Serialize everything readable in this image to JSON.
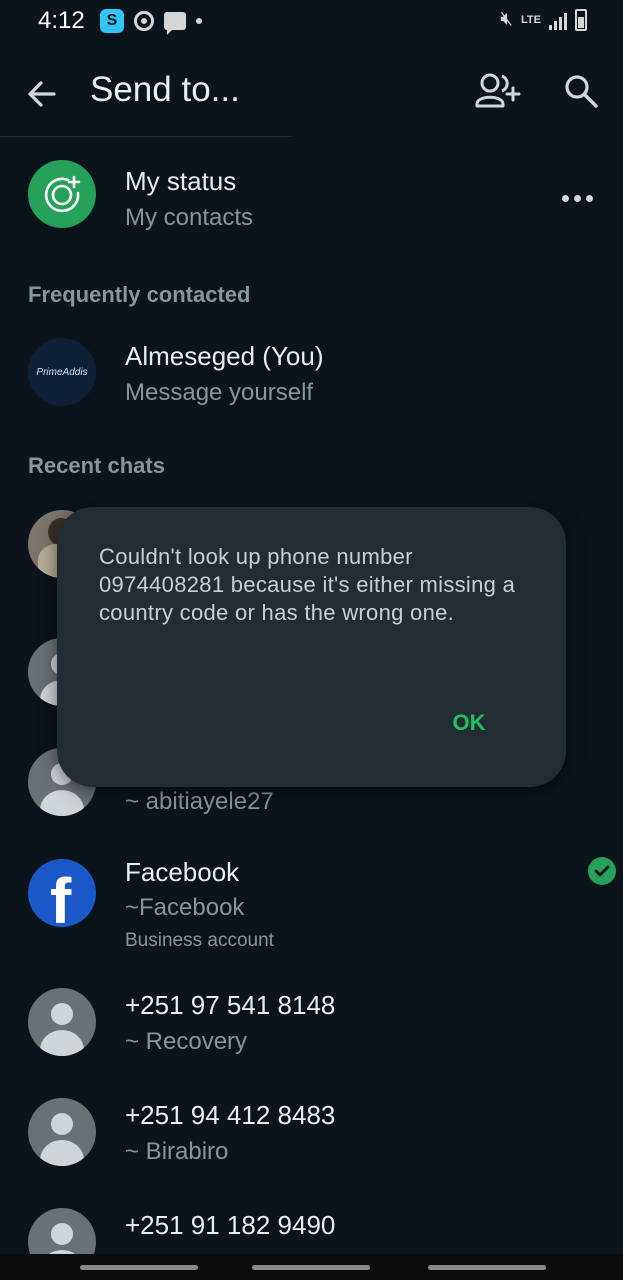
{
  "status_bar": {
    "time": "4:12",
    "app_icon_letter": "S",
    "network": "LTE"
  },
  "header": {
    "title": "Send to..."
  },
  "my_status": {
    "name": "My status",
    "subtitle": "My contacts"
  },
  "sections": {
    "frequent": "Frequently contacted",
    "recent": "Recent chats"
  },
  "frequent_contacts": [
    {
      "name": "Almeseged (You)",
      "subtitle": "Message yourself",
      "avatar_text": "PrimeAddis"
    }
  ],
  "recent_chats": [
    {
      "subtitle": "~ abitiayele27"
    },
    {
      "name": "Facebook",
      "subtitle": "~Facebook",
      "note": "Business account"
    },
    {
      "name": "+251 97 541 8148",
      "subtitle": "~ Recovery"
    },
    {
      "name": "+251 94 412 8483",
      "subtitle": "~ Birabiro"
    },
    {
      "name": "+251 91 182 9490"
    }
  ],
  "dialog": {
    "message": "Couldn't look up phone number 0974408281 because it's either missing a country code or has the wrong one.",
    "ok_label": "OK"
  },
  "colors": {
    "background": "#0b141a",
    "accent": "#21c063",
    "dialog_bg": "#222d33"
  }
}
